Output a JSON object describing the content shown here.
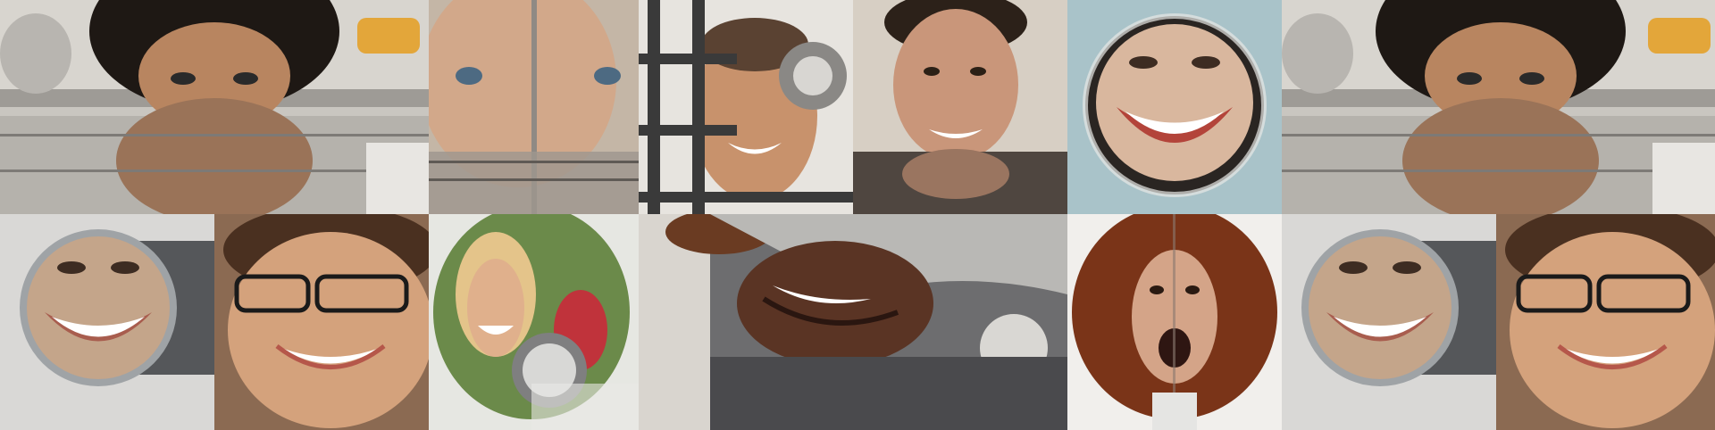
{
  "collage": {
    "tiles": [
      {
        "subject": "woman-curly-hair-reflection"
      },
      {
        "subject": "man-through-glass-door"
      },
      {
        "subject": "man-behind-gas-grate"
      },
      {
        "subject": "man-smiling-reflection"
      },
      {
        "subject": "face-in-convex-knob"
      },
      {
        "subject": "woman-curly-hair-reflection-repeat"
      },
      {
        "subject": "face-in-round-lens"
      },
      {
        "subject": "woman-glasses-distorted"
      },
      {
        "subject": "woman-fisheye-bulb"
      },
      {
        "subject": "man-reflection-on-metal"
      },
      {
        "subject": "woman-red-curly-hair-split"
      },
      {
        "subject": "face-in-round-lens-repeat"
      },
      {
        "subject": "woman-glasses-distorted-repeat"
      }
    ]
  }
}
